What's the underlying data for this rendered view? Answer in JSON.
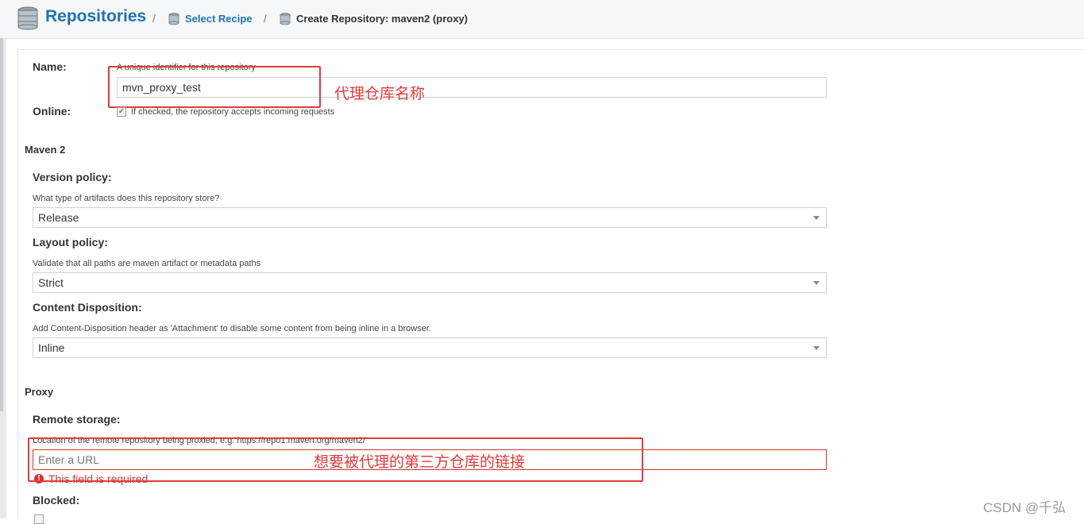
{
  "breadcrumb": {
    "title": "Repositories",
    "separator": "/",
    "select_recipe": "Select Recipe",
    "current": "Create Repository: maven2 (proxy)"
  },
  "name_field": {
    "label": "Name:",
    "help": "A unique identifier for this repository",
    "value": "mvn_proxy_test",
    "annotation": "代理仓库名称"
  },
  "online_field": {
    "label": "Online:",
    "checked": true,
    "check_mark": "✓",
    "help": "If checked, the repository accepts incoming requests"
  },
  "maven_section": {
    "title": "Maven 2",
    "version_policy": {
      "label": "Version policy:",
      "help": "What type of artifacts does this repository store?",
      "selected": "Release"
    },
    "layout_policy": {
      "label": "Layout policy:",
      "help": "Validate that all paths are maven artifact or metadata paths",
      "selected": "Strict"
    },
    "content_disposition": {
      "label": "Content Disposition:",
      "help": "Add Content-Disposition header as 'Attachment' to disable some content from being inline in a browser.",
      "selected": "Inline"
    }
  },
  "proxy_section": {
    "title": "Proxy",
    "remote_storage": {
      "label": "Remote storage:",
      "help": "Location of the remote repository being proxied, e.g. https://repo1.maven.org/maven2/",
      "placeholder": "Enter a URL",
      "error": "This field is required",
      "error_icon": "!",
      "annotation": "想要被代理的第三方仓库的链接"
    },
    "blocked": {
      "label": "Blocked:"
    }
  },
  "watermark": "CSDN @千弘",
  "colors": {
    "link": "#1d73b7",
    "annotation": "#e33a3a",
    "error": "#d9342b"
  }
}
